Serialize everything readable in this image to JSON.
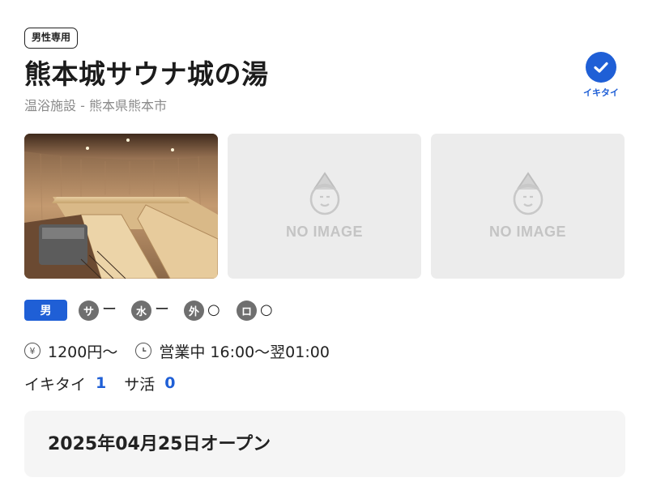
{
  "facility": {
    "gender_badge": "男性専用",
    "name": "熊本城サウナ城の湯",
    "subtitle": "温浴施設 - 熊本県熊本市"
  },
  "ikitai_button": {
    "label": "イキタイ",
    "icon": "checkmark-icon",
    "color": "#1f5fd6"
  },
  "gallery": {
    "photos": [
      {
        "type": "photo"
      },
      {
        "type": "placeholder",
        "text": "NO IMAGE"
      },
      {
        "type": "placeholder",
        "text": "NO IMAGE"
      }
    ]
  },
  "facilities": {
    "gender_tag": "男",
    "items": [
      {
        "icon": "サ",
        "mark": "ー"
      },
      {
        "icon": "水",
        "mark": "ー"
      },
      {
        "icon": "外",
        "mark": "○"
      },
      {
        "icon": "ロ",
        "mark": "○"
      }
    ]
  },
  "info": {
    "price_icon": "¥",
    "price": "1200円〜",
    "hours": "営業中 16:00〜翌01:00"
  },
  "counts": {
    "ikitai_label": "イキタイ",
    "ikitai_value": "1",
    "sakatsu_label": "サ活",
    "sakatsu_value": "0"
  },
  "opening": {
    "text": "2025年04月25日オープン"
  }
}
